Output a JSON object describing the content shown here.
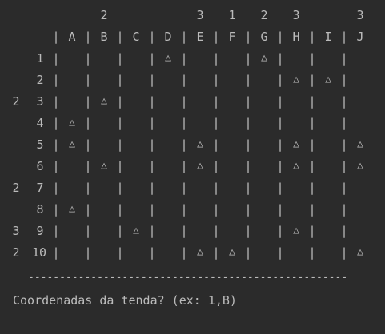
{
  "console": {
    "col_counts": [
      "",
      "2",
      "",
      "",
      "3",
      "1",
      "2",
      "3",
      "",
      "3"
    ],
    "col_letters": [
      "A",
      "B",
      "C",
      "D",
      "E",
      "F",
      "G",
      "H",
      "I",
      "J"
    ],
    "separator": "|",
    "tree_symbol": "△",
    "rows": [
      {
        "count": "",
        "label": "1",
        "cells": [
          "",
          "",
          "",
          "△",
          "",
          "",
          "△",
          "",
          "",
          ""
        ]
      },
      {
        "count": "",
        "label": "2",
        "cells": [
          "",
          "",
          "",
          "",
          "",
          "",
          "",
          "△",
          "△",
          ""
        ]
      },
      {
        "count": "2",
        "label": "3",
        "cells": [
          "",
          "△",
          "",
          "",
          "",
          "",
          "",
          "",
          "",
          ""
        ]
      },
      {
        "count": "",
        "label": "4",
        "cells": [
          "△",
          "",
          "",
          "",
          "",
          "",
          "",
          "",
          "",
          ""
        ]
      },
      {
        "count": "",
        "label": "5",
        "cells": [
          "△",
          "",
          "",
          "",
          "△",
          "",
          "",
          "△",
          "",
          "△"
        ]
      },
      {
        "count": "",
        "label": "6",
        "cells": [
          "",
          "△",
          "",
          "",
          "△",
          "",
          "",
          "△",
          "",
          "△"
        ]
      },
      {
        "count": "2",
        "label": "7",
        "cells": [
          "",
          "",
          "",
          "",
          "",
          "",
          "",
          "",
          "",
          ""
        ]
      },
      {
        "count": "",
        "label": "8",
        "cells": [
          "△",
          "",
          "",
          "",
          "",
          "",
          "",
          "",
          "",
          ""
        ]
      },
      {
        "count": "3",
        "label": "9",
        "cells": [
          "",
          "",
          "△",
          "",
          "",
          "",
          "",
          "△",
          "",
          ""
        ]
      },
      {
        "count": "2",
        "label": "10",
        "cells": [
          "",
          "",
          "",
          "",
          "△",
          "△",
          "",
          "",
          "",
          "△"
        ]
      }
    ],
    "divider": "---------------------------------------------------",
    "prompt": "Coordenadas da tenda? (ex: 1,B)"
  }
}
